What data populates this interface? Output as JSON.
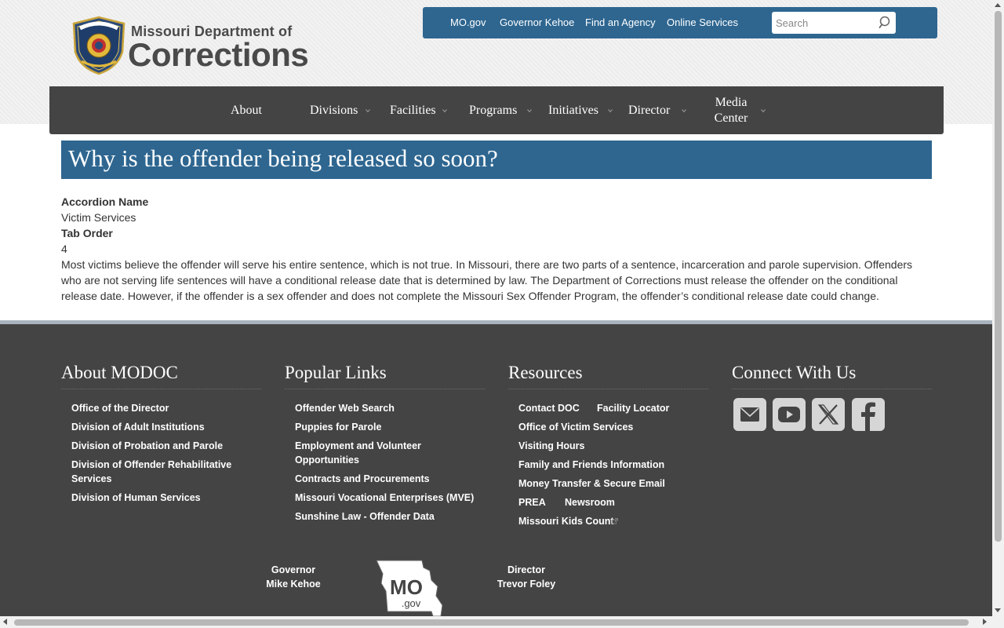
{
  "logo": {
    "line1": "Missouri Department of",
    "line2": "Corrections",
    "seal_icon": "missouri-corrections-seal-icon"
  },
  "utility_nav": {
    "links": [
      "MO.gov",
      "Governor Kehoe",
      "Find an Agency",
      "Online Services"
    ],
    "search_placeholder": "Search",
    "search_icon": "search-icon"
  },
  "main_nav": {
    "items": [
      {
        "label": "About"
      },
      {
        "label": "Divisions"
      },
      {
        "label": "Facilities"
      },
      {
        "label": "Programs"
      },
      {
        "label": "Initiatives"
      },
      {
        "label": "Director"
      },
      {
        "label": "Media Center"
      }
    ]
  },
  "page": {
    "title": "Why is the offender being released so soon?",
    "fields": [
      {
        "label": "Accordion Name",
        "value": "Victim Services"
      },
      {
        "label": "Tab Order",
        "value": "4"
      }
    ],
    "body": "Most victims believe the offender will serve his entire sentence, which is not true. In Missouri, there are two parts of a sentence, incarceration and parole supervision. Offenders who are not serving life sentences will have a conditional release date that is determined by law. The Department of Corrections must release the offender on the conditional release date. However, if the offender is a sex offender and does not complete the Missouri Sex Offender Program, the offender’s conditional release date could change."
  },
  "footer": {
    "about": {
      "heading": "About MODOC",
      "links": [
        "Office of the Director",
        "Division of Adult Institutions",
        "Division of Probation and Parole",
        "Division of Offender Rehabilitative Services",
        "Division of Human Services"
      ]
    },
    "popular": {
      "heading": "Popular Links",
      "links": [
        "Offender Web Search",
        "Puppies for Parole",
        "Employment and Volunteer Opportunities",
        "Contracts and Procurements",
        "Missouri Vocational Enterprises (MVE)",
        "Sunshine Law - Offender Data"
      ]
    },
    "resources": {
      "heading": "Resources",
      "links": [
        "Contact DOC",
        "Facility Locator",
        "Office of Victim Services",
        "Visiting Hours",
        "Family and Friends Information",
        "Money Transfer & Secure Email",
        "PREA",
        "Newsroom",
        "Missouri Kids Count"
      ]
    },
    "connect": {
      "heading": "Connect With Us",
      "icons": [
        "email-icon",
        "youtube-icon",
        "x-twitter-icon",
        "facebook-icon"
      ]
    },
    "governor": {
      "title": "Governor",
      "name": "Mike Kehoe"
    },
    "director": {
      "title": "Director",
      "name": "Trevor Foley"
    },
    "mogov_logo": {
      "text": "MO",
      "subtext": ".gov"
    }
  },
  "colors": {
    "brand_blue": "#2e6690",
    "nav_dark": "#444444",
    "footer_dark": "#444444"
  }
}
